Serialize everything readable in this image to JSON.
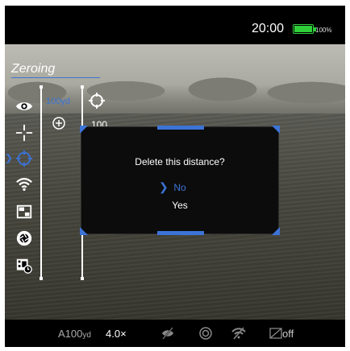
{
  "status": {
    "time": "20:00",
    "battery_percent_text": "100%",
    "battery_level": 1.0,
    "battery_color": "#2fcf3b"
  },
  "menu": {
    "title": "Zeroing",
    "accent_color": "#3c73d6",
    "sidebar_icons": [
      "eye-icon",
      "crosshair-icon",
      "target-icon",
      "wifi-icon",
      "pip-icon",
      "aperture-icon",
      "recording-settings-icon"
    ],
    "selected_index": 2
  },
  "zeroing": {
    "distance": "100yd",
    "add_icon": "plus-circle-icon",
    "value": "100"
  },
  "dialog": {
    "question": "Delete this distance?",
    "options": [
      "No",
      "Yes"
    ],
    "selected_option": "No"
  },
  "bottom_bar": {
    "profile_letter": "A",
    "profile_value": "100",
    "profile_unit": "yd",
    "zoom": "4.0×",
    "icons": [
      "stadiametric-off-icon",
      "auto-off-icon",
      "wifi-off-icon",
      "screen-off-icon"
    ],
    "mode": "off"
  }
}
